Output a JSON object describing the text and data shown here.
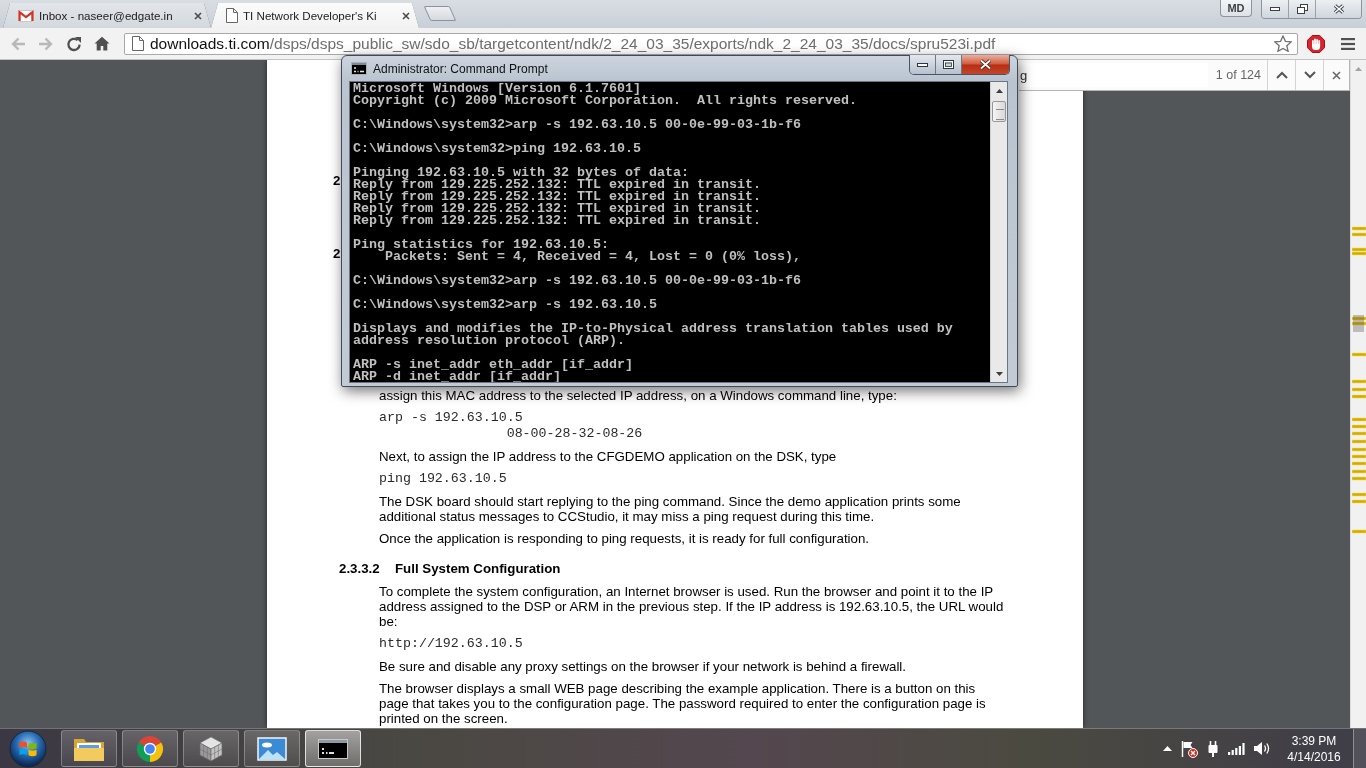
{
  "browser": {
    "tabs": [
      {
        "kind": "mail",
        "title": "Inbox - naseer@edgate.in",
        "selected": false
      },
      {
        "kind": "page",
        "title": "TI Network Developer's Ki",
        "selected": true
      }
    ],
    "profile": "MD",
    "nav_buttons": [
      {
        "kind": "back",
        "disabled": true
      },
      {
        "kind": "forward",
        "disabled": true
      },
      {
        "kind": "reload",
        "disabled": false
      },
      {
        "kind": "home",
        "disabled": false
      }
    ],
    "address": {
      "host": "downloads.ti.com",
      "path": "/dsps/dsps_public_sw/sdo_sb/targetcontent/ndk/2_24_03_35/exports/ndk_2_24_03_35/docs/spru523i.pdf"
    }
  },
  "find_bar": {
    "value": "g",
    "count": "1 of 124"
  },
  "document": {
    "covered_headings": [
      "2",
      "2"
    ],
    "blocks": [
      {
        "kind": "text",
        "text": "assign this MAC address to the selected IP address, on a Windows command line, type:"
      },
      {
        "kind": "code",
        "lines": [
          "arp -s 192.63.10.5",
          "08-00-28-32-08-26"
        ]
      },
      {
        "kind": "text",
        "text": "Next, to assign the IP address to the CFGDEMO application on the DSK, type"
      },
      {
        "kind": "code",
        "lines": [
          "ping 192.63.10.5"
        ]
      },
      {
        "kind": "text",
        "text": "The DSK board should start replying to the ping command. Since the demo application prints some additional status messages to CCStudio, it may miss a ping request during this time."
      },
      {
        "kind": "text",
        "text": "Once the application is responding to ping requests, it is ready for full configuration."
      },
      {
        "kind": "heading",
        "number": "2.3.3.2",
        "title": "Full System Configuration"
      },
      {
        "kind": "text",
        "text": "To complete the system configuration, an Internet browser is used. Run the browser and point it to the IP address assigned to the DSP or ARM in the previous step. If the IP address is 192.63.10.5, the URL would be:"
      },
      {
        "kind": "code",
        "lines": [
          "http://192.63.10.5"
        ]
      },
      {
        "kind": "text",
        "text": "Be sure and disable any proxy settings on the browser if your network is behind a firewall."
      },
      {
        "kind": "text",
        "text": "The browser displays a small WEB page describing the example application. There is a button on this page that takes you to the configuration page. The password required to enter the configuration page is printed on the screen."
      }
    ]
  },
  "command_prompt": {
    "title": "Administrator: Command Prompt",
    "blocks": [
      [
        "Microsoft Windows [Version 6.1.7601]",
        "Copyright (c) 2009 Microsoft Corporation.  All rights reserved."
      ],
      [
        "C:\\Windows\\system32>arp -s 192.63.10.5 00-0e-99-03-1b-f6"
      ],
      [
        "C:\\Windows\\system32>ping 192.63.10.5"
      ],
      [
        "Pinging 192.63.10.5 with 32 bytes of data:",
        "Reply from 129.225.252.132: TTL expired in transit.",
        "Reply from 129.225.252.132: TTL expired in transit.",
        "Reply from 129.225.252.132: TTL expired in transit.",
        "Reply from 129.225.252.132: TTL expired in transit."
      ],
      [
        "Ping statistics for 192.63.10.5:",
        "    Packets: Sent = 4, Received = 4, Lost = 0 (0% loss),"
      ],
      [
        "C:\\Windows\\system32>arp -s 192.63.10.5 00-0e-99-03-1b-f6"
      ],
      [
        "C:\\Windows\\system32>arp -s 192.63.10.5"
      ],
      [
        "Displays and modifies the IP-to-Physical address translation tables used by",
        "address resolution protocol (ARP)."
      ],
      [
        "ARP -s inet_addr eth_addr [if_addr]",
        "ARP -d inet_addr [if_addr]"
      ]
    ]
  },
  "taskbar": {
    "apps": [
      {
        "kind": "files",
        "selected": false
      },
      {
        "kind": "browser",
        "selected": false
      },
      {
        "kind": "cube",
        "selected": false
      },
      {
        "kind": "photos",
        "selected": false
      },
      {
        "kind": "console",
        "selected": true
      }
    ],
    "clock": {
      "time": "3:39 PM",
      "date": "4/14/2016"
    }
  }
}
